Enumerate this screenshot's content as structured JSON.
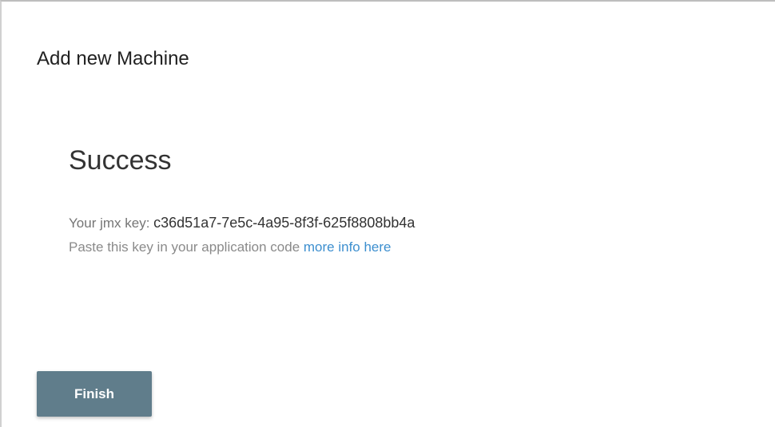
{
  "dialog": {
    "title": "Add new Machine"
  },
  "content": {
    "heading": "Success",
    "key_label": "Your jmx key: ",
    "key_value": "c36d51a7-7e5c-4a95-8f3f-625f8808bb4a",
    "info_text": "Paste this key in your application code ",
    "info_link": "more info here"
  },
  "actions": {
    "finish_label": "Finish"
  },
  "colors": {
    "button_bg": "#607d8b",
    "link": "#3d8fcf"
  }
}
